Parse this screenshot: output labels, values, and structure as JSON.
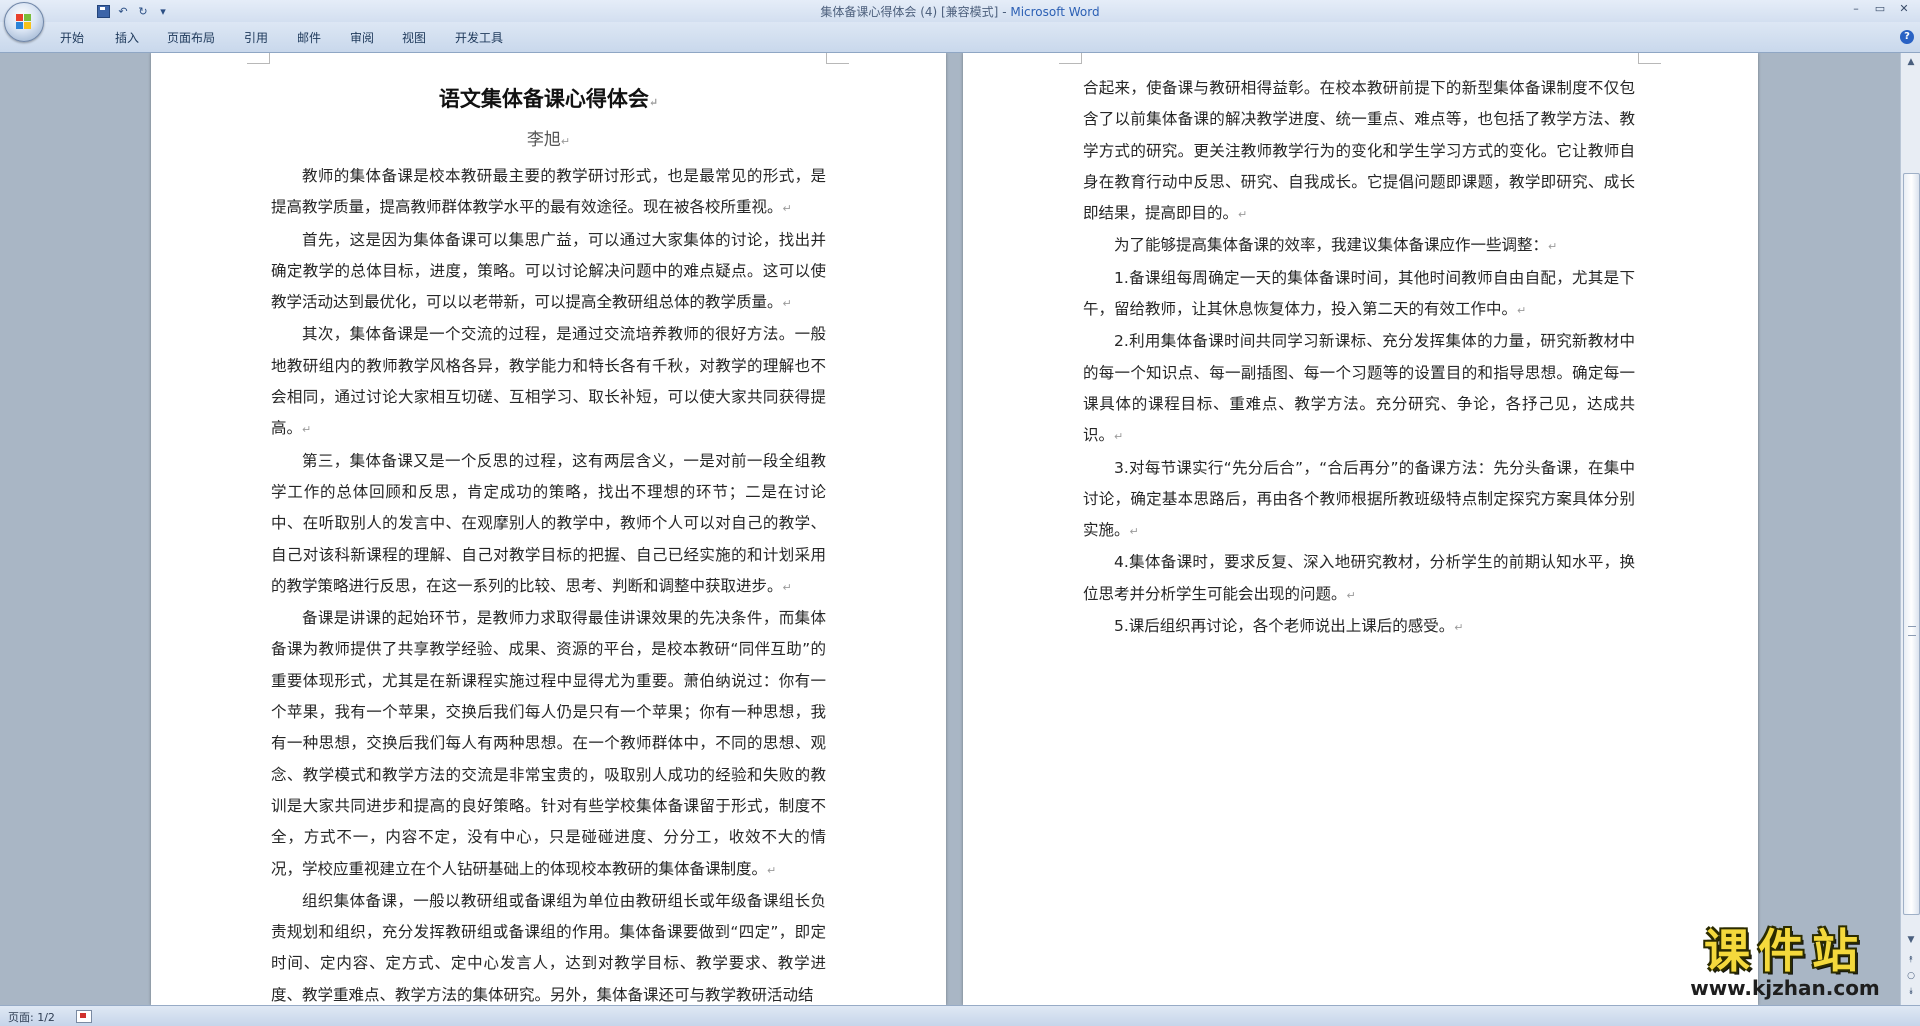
{
  "window": {
    "title_doc": "集体备课心得体会 (4) [兼容模式]",
    "title_sep": " - ",
    "title_app": "Microsoft Word",
    "minimize_label": "–",
    "restore_label": "▭",
    "close_label": "✕"
  },
  "quick_access": {
    "undo_label": "↶",
    "redo_label": "↻",
    "customize_label": "▾"
  },
  "ribbon": {
    "tabs": [
      "开始",
      "插入",
      "页面布局",
      "引用",
      "邮件",
      "审阅",
      "视图",
      "开发工具"
    ],
    "help_label": "?"
  },
  "document": {
    "paragraph_mark": "↵",
    "title": "语文集体备课心得体会",
    "author": "李旭",
    "page1_paragraphs": [
      "教师的集体备课是校本教研最主要的教学研讨形式，也是最常见的形式，是提高教学质量，提高教师群体教学水平的最有效途径。现在被各校所重视。",
      "首先，这是因为集体备课可以集思广益，可以通过大家集体的讨论，找出并确定教学的总体目标，进度，策略。可以讨论解决问题中的难点疑点。这可以使教学活动达到最优化，可以以老带新，可以提高全教研组总体的教学质量。",
      "其次，集体备课是一个交流的过程，是通过交流培养教师的很好方法。一般地教研组内的教师教学风格各异，教学能力和特长各有千秋，对教学的理解也不会相同，通过讨论大家相互切磋、互相学习、取长补短，可以使大家共同获得提高。",
      "第三，集体备课又是一个反思的过程，这有两层含义，一是对前一段全组教学工作的总体回顾和反思，肯定成功的策略，找出不理想的环节；二是在讨论中、在听取别人的发言中、在观摩别人的教学中，教师个人可以对自己的教学、自己对该科新课程的理解、自己对教学目标的把握、自己已经实施的和计划采用的教学策略进行反思，在这一系列的比较、思考、判断和调整中获取进步。",
      "备课是讲课的起始环节，是教师力求取得最佳讲课效果的先决条件，而集体备课为教师提供了共享教学经验、成果、资源的平台，是校本教研“同伴互助”的重要体现形式，尤其是在新课程实施过程中显得尤为重要。萧伯纳说过：你有一个苹果，我有一个苹果，交换后我们每人仍是只有一个苹果；你有一种思想，我有一种思想，交换后我们每人有两种思想。在一个教师群体中，不同的思想、观念、教学模式和教学方法的交流是非常宝贵的，吸取别人成功的经验和失败的教训是大家共同进步和提高的良好策略。针对有些学校集体备课留于形式，制度不全，方式不一，内容不定，没有中心，只是碰碰进度、分分工，收效不大的情况，学校应重视建立在个人钻研基础上的体现校本教研的集体备课制度。",
      "组织集体备课，一般以教研组或备课组为单位由教研组长或年级备课组长负责规划和组织，充分发挥教研组或备课组的作用。集体备课要做到“四定”，即定时间、定内容、定方式、定中心发言人，达到对教学目标、教学要求、教学进度、教学重难点、教学方法的集体研究。另外，集体备课还可与教学教研活动结"
    ],
    "page2_continuation": "合起来，使备课与教研相得益彰。在校本教研前提下的新型集体备课制度不仅包含了以前集体备课的解决教学进度、统一重点、难点等，也包括了教学方法、教学方式的研究。更关注教师教学行为的变化和学生学习方式的变化。它让教师自身在教育行动中反思、研究、自我成长。它提倡问题即课题，教学即研究、成长即结果，提高即目的。",
    "page2_paragraphs": [
      "为了能够提高集体备课的效率，我建议集体备课应作一些调整：",
      "1.备课组每周确定一天的集体备课时间，其他时间教师自由自配，尤其是下午，留给教师，让其休息恢复体力，投入第二天的有效工作中。",
      "2.利用集体备课时间共同学习新课标、充分发挥集体的力量，研究新教材中的每一个知识点、每一副插图、每一个习题等的设置目的和指导思想。确定每一课具体的课程目标、重难点、教学方法。充分研究、争论，各抒己见，达成共识。",
      "3.对每节课实行“先分后合”，“合后再分”的备课方法：先分头备课，在集中讨论，确定基本思路后，再由各个教师根据所教班级特点制定探究方案具体分别实施。",
      "4.集体备课时，要求反复、深入地研究教材，分析学生的前期认知水平，换位思考并分析学生可能会出现的问题。",
      "5.课后组织再讨论，各个老师说出上课后的感受。"
    ]
  },
  "scrollbar": {
    "up_label": "▲",
    "down_label": "▼",
    "prev_page_label": "⯭",
    "select_browse_label": "○",
    "next_page_label": "⯯"
  },
  "statusbar": {
    "page_count": "页面: 1/2"
  },
  "watermark": {
    "title": "课件站",
    "url": "www.kjzhan.com"
  },
  "colors": {
    "office_logo": [
      "#e8412c",
      "#7bbd3a",
      "#2c84d8",
      "#f7c21b"
    ],
    "app_title": "#2b5fb4"
  }
}
